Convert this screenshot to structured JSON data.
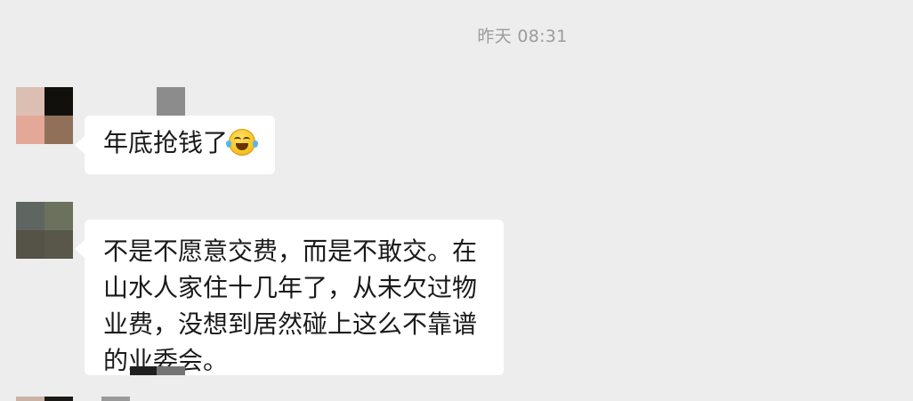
{
  "chat": {
    "timestamp": "昨天 08:31",
    "messages": [
      {
        "text": "年底抢钱了",
        "emoji": "laugh-tears-emoji"
      },
      {
        "text": "不是不愿意交费，而是不敢交。在\n山水人家住十几年了，从未欠过物\n业费，没想到居然碰上这么不靠谱\n的业委会。"
      }
    ]
  },
  "colors": {
    "background": "#ededed",
    "bubble": "#ffffff",
    "timestamp_text": "#9b9b9b"
  }
}
